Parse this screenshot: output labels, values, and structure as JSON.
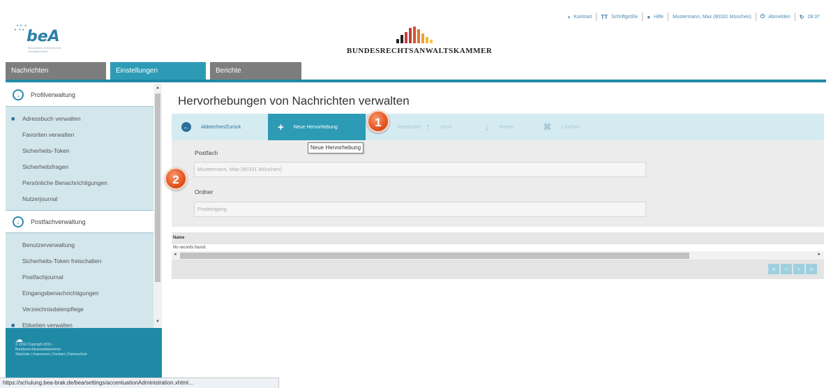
{
  "header": {
    "bea_logo": "beA",
    "bea_logo_sub": "Besonderes elektronisches Anwaltspostfach",
    "brak_title": "BUNDESRECHTSANWALTSKAMMER",
    "brak_colors": [
      "#c7403a",
      "#e2762a",
      "#f4b93a",
      "#222222"
    ],
    "links": [
      {
        "icon": "info-icon",
        "glyph": "◑",
        "label": "Kontrast"
      },
      {
        "icon": "font-size-icon",
        "glyph": "TT",
        "label": "Schriftgröße"
      },
      {
        "icon": "help-icon",
        "glyph": "●",
        "label": "Hilfe"
      },
      {
        "icon": "user-icon",
        "glyph": "",
        "label": "Mustermann, Max (80331 München)"
      },
      {
        "icon": "logout-icon",
        "glyph": "⏻",
        "label": "Abmelden"
      },
      {
        "icon": "refresh-icon",
        "glyph": "↻",
        "label": "28:37"
      }
    ]
  },
  "tabs": [
    {
      "label": "Nachrichten",
      "active": false
    },
    {
      "label": "Einstellungen",
      "active": true
    },
    {
      "label": "Berichte",
      "active": false
    }
  ],
  "sidebar": {
    "section1": "Profilverwaltung",
    "section1_items": [
      "Adressbuch verwalten",
      "Favoriten verwalten",
      "Sicherheits-Token",
      "Sicherheitsfragen",
      "Persönliche Benachrichtigungen",
      "Nutzerjournal"
    ],
    "section2": "Postfachverwaltung",
    "section2_items": [
      "Benutzerverwaltung",
      "Sicherheits-Token freischalten",
      "Postfachjournal",
      "Eingangsbenachrichtigungen",
      "Verzeichnisdatenpflege",
      "Etiketten verwalten"
    ],
    "footer_lines": [
      "© 2016 Copyright 2016 -",
      "Bundesrechtsanwaltskammer",
      "Startseite | Impressum | Kontakt | Datenschutz"
    ]
  },
  "status_url": "https://schulung.bea-brak.de/bea/settings/accentuationAdministration.xhtml...",
  "content": {
    "title": "Hervorhebungen von Nachrichten verwalten",
    "toolbar": [
      {
        "name": "abbrechen",
        "icon": "back-icon",
        "glyph": "←",
        "label": "Abbrechen/Zurück",
        "state": "normal"
      },
      {
        "name": "neue-hervorhebung",
        "icon": "plus-icon",
        "glyph": "+",
        "label": "Neue Hervorhebung",
        "state": "active"
      },
      {
        "name": "bearbeiten",
        "icon": "edit-icon",
        "glyph": "✎",
        "label": "Bearbeiten",
        "state": "disabled"
      },
      {
        "name": "hoch",
        "icon": "arrow-up-icon",
        "glyph": "↑",
        "label": "Hoch",
        "state": "disabled"
      },
      {
        "name": "runter",
        "icon": "arrow-down-icon",
        "glyph": "↓",
        "label": "Runter",
        "state": "disabled"
      },
      {
        "name": "loeschen",
        "icon": "delete-icon",
        "glyph": "✖",
        "label": "Löschen",
        "state": "disabled"
      }
    ],
    "tooltip": "Neue Hervorhebung",
    "postfach_label": "Postfach",
    "postfach_value": "Mustermann, Max (80331 München)",
    "ordner_label": "Ordner",
    "ordner_value": "Posteingang",
    "table_header": "Name",
    "no_records": "No records found.",
    "pager": [
      "«",
      "‹",
      "›",
      "»"
    ]
  },
  "markers": [
    "1",
    "2"
  ]
}
